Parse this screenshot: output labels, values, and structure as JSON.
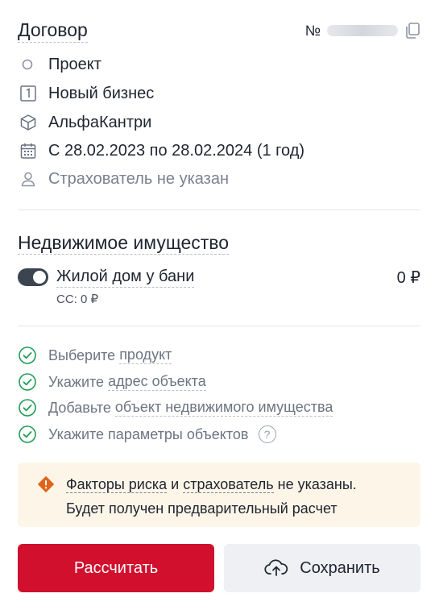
{
  "contract": {
    "title": "Договор",
    "number_label": "№",
    "status": "Проект",
    "business_type": "Новый бизнес",
    "product": "АльфаКантри",
    "period": "С 28.02.2023 по 28.02.2024 (1 год)",
    "insurer": "Страхователь не указан"
  },
  "property": {
    "section_title": "Недвижимое имущество",
    "item_name": "Жилой дом у бани",
    "item_price": "0 ₽",
    "item_sum": "СС: 0 ₽",
    "toggle_on": true
  },
  "checklist": [
    {
      "prefix": "Выберите ",
      "link": "продукт"
    },
    {
      "prefix": "Укажите ",
      "link": "адрес объекта"
    },
    {
      "prefix": "Добавьте ",
      "link": "объект недвижимого имущества"
    },
    {
      "prefix": "Укажите параметры объектов",
      "link": "",
      "help": "?"
    }
  ],
  "warning": {
    "link1": "Факторы риска",
    "and": "и",
    "link2": "страхователь",
    "suffix": "не указаны.",
    "line2": "Будет получен предварительный расчет"
  },
  "buttons": {
    "calculate": "Рассчитать",
    "save": "Сохранить"
  },
  "colors": {
    "primary": "#d1102e",
    "check": "#1f9d55",
    "warning_bg": "#fdf6e8",
    "warning_icon": "#e0651a"
  }
}
